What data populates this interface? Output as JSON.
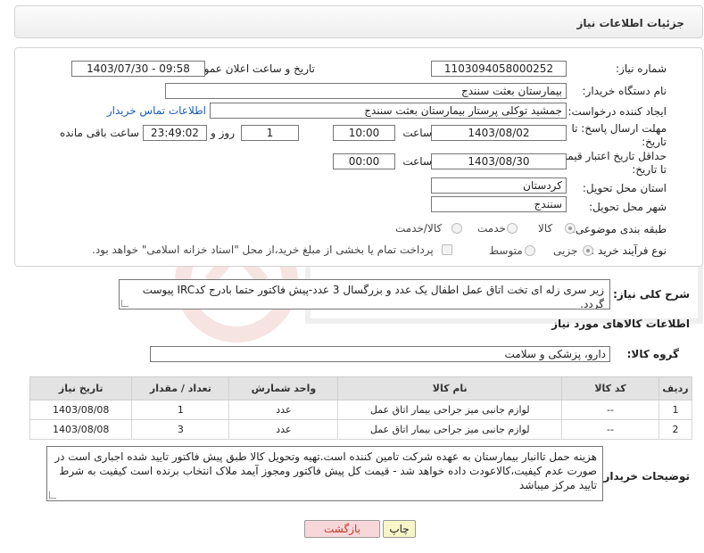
{
  "header": {
    "title": "جزئیات اطلاعات نیاز"
  },
  "form": {
    "need_number_label": "شماره نیاز:",
    "need_number": "1103094058000252",
    "announce_label": "تاریخ و ساعت اعلان عمومی:",
    "announce_value": "1403/07/30 - 09:58",
    "buyer_org_label": "نام دستگاه خریدار:",
    "buyer_org": "بیمارستان بعثت سنندج",
    "creator_label": "ایجاد کننده درخواست:",
    "creator": "جمشید  توکلی پرستار بیمارستان بعثت سنندج",
    "contact_link": "اطلاعات تماس خریدار",
    "deadline_label": "مهلت ارسال پاسخ: تا تاریخ:",
    "deadline_date": "1403/08/02",
    "time_label": "ساعت",
    "deadline_time": "10:00",
    "days_value": "1",
    "days_label": "روز و",
    "remaining_time": "23:49:02",
    "remaining_label": "ساعت باقی مانده",
    "validity_label": "حداقل تاریخ اعتبار قیمت: تا تاریخ:",
    "validity_date": "1403/08/30",
    "validity_time_label": "ساعت",
    "validity_time": "00:00",
    "province_label": "استان محل تحویل:",
    "province": "کردستان",
    "city_label": "شهر محل تحویل:",
    "city": "سنندج",
    "category_label": "طبقه بندی موضوعی:",
    "category_options": [
      "کالا",
      "خدمت",
      "کالا/خدمت"
    ],
    "process_label": "نوع فرآیند خرید :",
    "process_options": [
      "جزیی",
      "متوسط"
    ],
    "payment_note": "پرداخت تمام یا بخشی از مبلغ خرید،از محل \"اسناد خزانه اسلامی\" خواهد بود."
  },
  "description": {
    "label": "شرح کلی نیاز:",
    "text": "زیر سری زله ای تخت اتاق عمل اطفال یک عدد و بزرگسال 3 عدد-پیش فاکتور حتما بادرج کدIRC پیوست گردد."
  },
  "goods": {
    "section_title": "اطلاعات کالاهای مورد نیاز",
    "group_label": "گروه کالا:",
    "group_value": "دارو، پزشکی و سلامت",
    "columns": [
      "ردیف",
      "کد کالا",
      "نام کالا",
      "واحد شمارش",
      "تعداد / مقدار",
      "تاریخ نیاز"
    ],
    "rows": [
      [
        "1",
        "--",
        "لوازم جانبی میز جراحی بیمار اتاق عمل",
        "عدد",
        "1",
        "1403/08/08"
      ],
      [
        "2",
        "--",
        "لوازم جانبی میز جراحی بیمار اتاق عمل",
        "عدد",
        "3",
        "1403/08/08"
      ]
    ]
  },
  "buyer_notes": {
    "label": "توضیحات خریدار:",
    "text": "هزینه حمل تاانبار بیمارستان به عهده شرکت تامین کننده است.تهیه وتحویل کالا طبق پیش فاکتور تایید شده اجباری است در صورت عدم کیفیت،کالاعودت داده خواهد شد - قیمت کل پیش فاکتور ومجوز آیمد ملاک انتخاب برنده است کیفیت به شرط تایید مرکز میباشد"
  },
  "buttons": {
    "print": "چاپ",
    "back": "بازگشت"
  },
  "colors": {
    "link": "#1a5fb4",
    "back_button_bg": "#f8d7da",
    "print_button_bg": "#f6f6c8"
  }
}
